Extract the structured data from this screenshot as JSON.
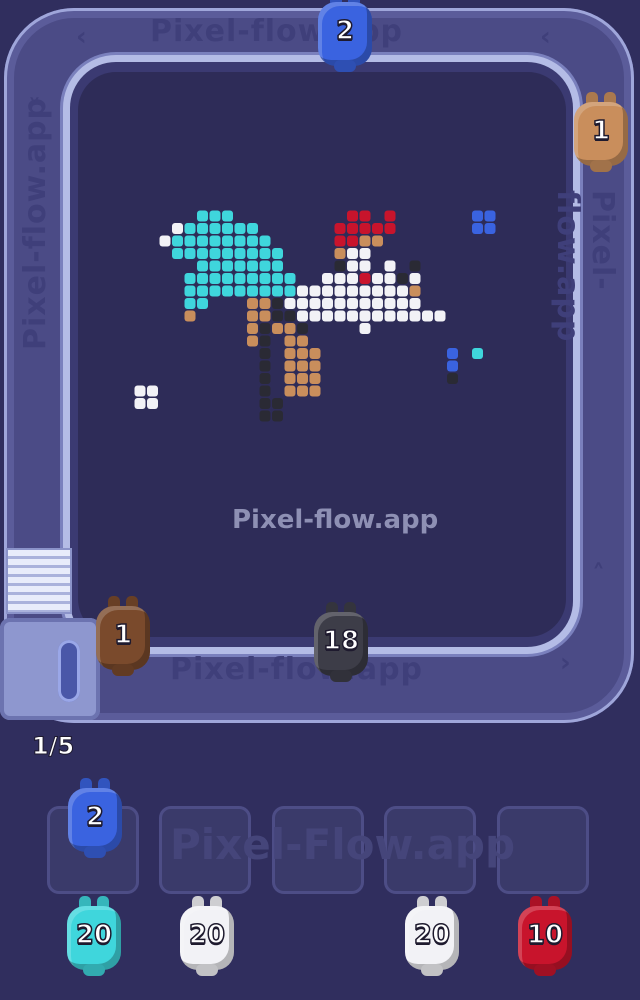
{
  "game": {
    "watermark": "Pixel-flow.app",
    "track_watermark": "Pixel-flow.app",
    "slot_counter": "1/5",
    "colors": {
      "background": "#302e5e",
      "blue": "#3a63e0",
      "tan": "#c98e5c",
      "brown": "#7a4a2c",
      "dark": "#3d3d48",
      "cyan": "#3fd6dc",
      "white": "#f2f2f6",
      "red": "#c8142c"
    },
    "track_animals": [
      {
        "name": "blue-animal",
        "count": "2",
        "color": "blue"
      },
      {
        "name": "tan-animal",
        "count": "1",
        "color": "tan"
      },
      {
        "name": "brown-animal",
        "count": "1",
        "color": "brown"
      },
      {
        "name": "dark-animal",
        "count": "18",
        "color": "dark"
      }
    ],
    "slots": [
      {
        "occupied": true,
        "animal": {
          "count": "2",
          "color": "blue"
        }
      },
      {
        "occupied": false
      },
      {
        "occupied": false
      },
      {
        "occupied": false
      },
      {
        "occupied": false
      }
    ],
    "queue": [
      {
        "count": "20",
        "color": "cyan"
      },
      {
        "count": "20",
        "color": "white"
      },
      {
        "count": "20",
        "color": "white"
      },
      {
        "count": "10",
        "color": "red"
      }
    ]
  }
}
